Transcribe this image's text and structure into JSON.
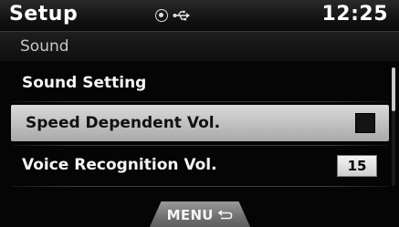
{
  "header": {
    "title": "Setup",
    "time": "12:25",
    "icons": [
      "disc-icon",
      "usb-icon"
    ]
  },
  "subheader": {
    "label": "Sound"
  },
  "menu": {
    "items": [
      {
        "label": "Sound Setting"
      },
      {
        "label": "Speed Dependent Vol.",
        "selected": true,
        "control": "checkbox",
        "checked": false
      },
      {
        "label": "Voice Recognition Vol.",
        "control": "value",
        "value": "15"
      }
    ]
  },
  "footer": {
    "menu_label": "MENU",
    "menu_icon": "back-arrow-icon"
  },
  "colors": {
    "background": "#050505",
    "highlight": "#c8c8c8",
    "text": "#f5f5f5",
    "highlight_text": "#111111"
  }
}
